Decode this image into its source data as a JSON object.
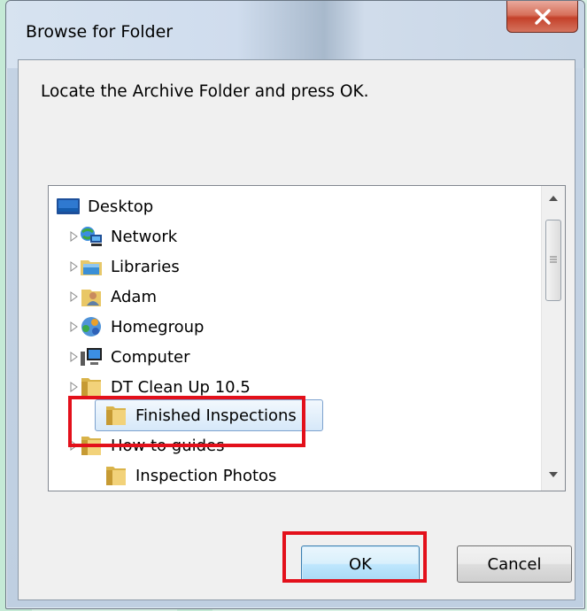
{
  "dialog": {
    "title": "Browse for Folder",
    "prompt": "Locate the Archive Folder and press OK."
  },
  "tree": {
    "items": [
      {
        "label": "Desktop",
        "icon": "desktop-icon"
      },
      {
        "label": "Network",
        "icon": "network-icon"
      },
      {
        "label": "Libraries",
        "icon": "libraries-icon"
      },
      {
        "label": "Adam",
        "icon": "user-folder-icon"
      },
      {
        "label": "Homegroup",
        "icon": "homegroup-icon"
      },
      {
        "label": "Computer",
        "icon": "computer-icon"
      },
      {
        "label": "DT Clean Up 10.5",
        "icon": "folder-icon"
      },
      {
        "label": "Finished Inspections",
        "icon": "folder-icon",
        "selected": true
      },
      {
        "label": "How to guides",
        "icon": "folder-icon"
      },
      {
        "label": "Inspection Photos",
        "icon": "folder-icon"
      }
    ]
  },
  "buttons": {
    "ok": "OK",
    "cancel": "Cancel"
  },
  "colors": {
    "highlight": "#e3101b",
    "selection": "#d6e8f9",
    "close_button": "#c4412a"
  }
}
